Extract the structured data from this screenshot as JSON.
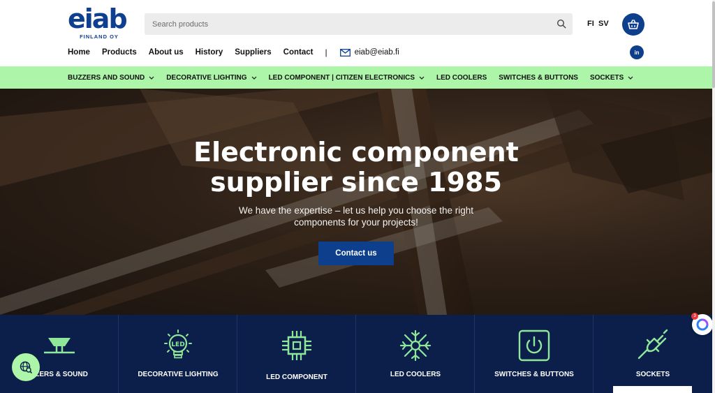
{
  "header": {
    "logo_text": "eiab",
    "logo_sub": "FINLAND OY",
    "search_placeholder": "Search products",
    "languages": [
      "FI",
      "SV"
    ],
    "email": "eiab@eiab.fi",
    "linkedin_label": "in"
  },
  "nav": {
    "items": [
      "Home",
      "Products",
      "About us",
      "History",
      "Suppliers",
      "Contact"
    ],
    "separator": "|"
  },
  "categories": [
    {
      "label": "BUZZERS AND SOUND",
      "dropdown": true
    },
    {
      "label": "DECORATIVE LIGHTING",
      "dropdown": true
    },
    {
      "label": "LED COMPONENT | CITIZEN ELECTRONICS",
      "dropdown": true
    },
    {
      "label": "LED COOLERS",
      "dropdown": false
    },
    {
      "label": "SWITCHES & BUTTONS",
      "dropdown": false
    },
    {
      "label": "SOCKETS",
      "dropdown": true
    }
  ],
  "hero": {
    "title_line1": "Electronic component",
    "title_line2": "supplier since 1985",
    "subtitle_line1": "We have the expertise – let us help you choose the right",
    "subtitle_line2": "components for your projects!",
    "cta": "Contact us"
  },
  "tiles": [
    {
      "label": "ZZERS & SOUND",
      "icon": "buzzer-icon"
    },
    {
      "label": "DECORATIVE LIGHTING",
      "icon": "led-bulb-icon"
    },
    {
      "label": "LED COMPONENT",
      "icon": "chip-icon"
    },
    {
      "label": "LED COOLERS",
      "icon": "snowflake-icon"
    },
    {
      "label": "SWITCHES & BUTTONS",
      "icon": "power-switch-icon"
    },
    {
      "label": "SOCKETS",
      "icon": "plug-icon"
    }
  ],
  "chat_badge": "3",
  "colors": {
    "brand_blue": "#0d3f8c",
    "accent_green": "#adf5a8",
    "tile_bg": "#0c1f4a",
    "icon_green": "#8fe89a"
  }
}
